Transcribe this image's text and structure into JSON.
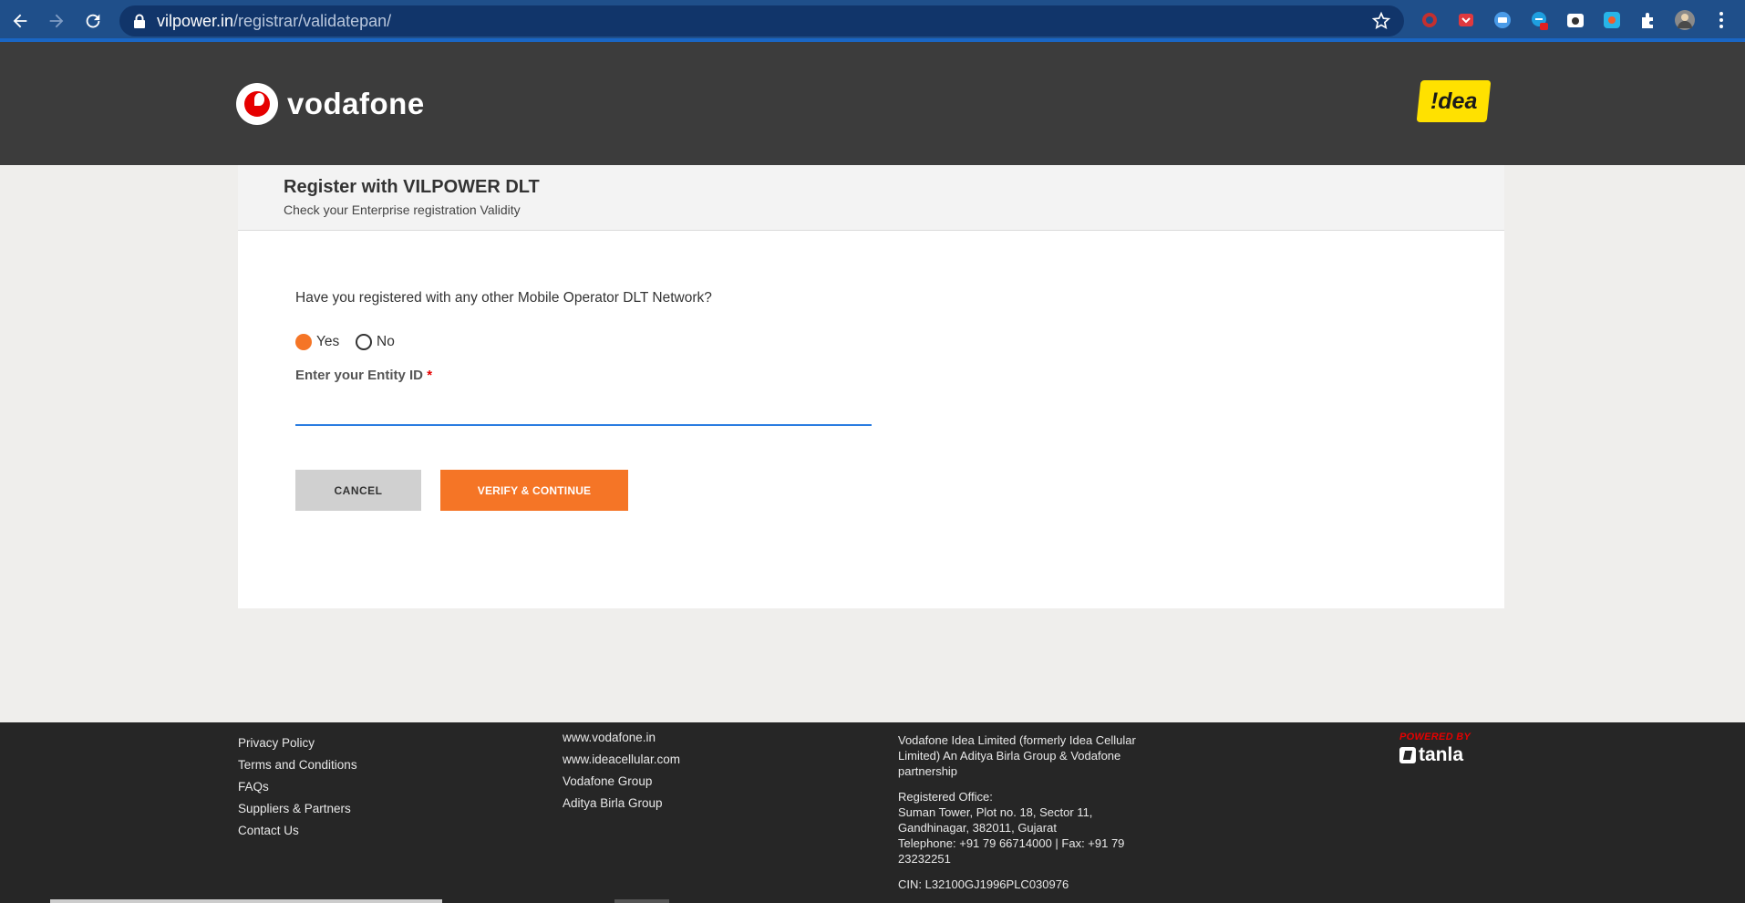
{
  "browser": {
    "url_host": "vilpower.in",
    "url_path": "/registrar/validatepan/"
  },
  "header": {
    "vodafone_logo_text": "vodafone",
    "idea_logo_text": "!dea"
  },
  "card": {
    "title": "Register with VILPOWER DLT",
    "subtitle": "Check your Enterprise registration Validity",
    "question": "Have you registered with any other Mobile Operator DLT Network?",
    "radio_yes": "Yes",
    "radio_no": "No",
    "selected": "Yes",
    "entity_label": "Enter your Entity ID",
    "entity_required_mark": "*",
    "entity_value": "",
    "cancel_label": "CANCEL",
    "verify_label": "VERIFY & CONTINUE"
  },
  "footer": {
    "col1": [
      "Privacy Policy",
      "Terms and Conditions",
      "FAQs",
      "Suppliers & Partners",
      "Contact Us"
    ],
    "col2": [
      "www.vodafone.in",
      "www.ideacellular.com",
      "Vodafone Group",
      "Aditya Birla Group"
    ],
    "company": "Vodafone Idea Limited (formerly Idea Cellular Limited) An Aditya Birla Group & Vodafone partnership",
    "office_heading": "Registered Office:",
    "office_line1": "Suman Tower, Plot no. 18, Sector 11,",
    "office_line2": "Gandhinagar, 382011, Gujarat",
    "office_line3": "Telephone: +91 79 66714000 | Fax: +91 79 23232251",
    "cin": "CIN: L32100GJ1996PLC030976",
    "powered_by": "POWERED BY",
    "tanla": "tanla"
  },
  "colors": {
    "accent": "#f57526",
    "header_bg": "#3c3c3c",
    "chrome_bg": "#1f4f8a"
  }
}
